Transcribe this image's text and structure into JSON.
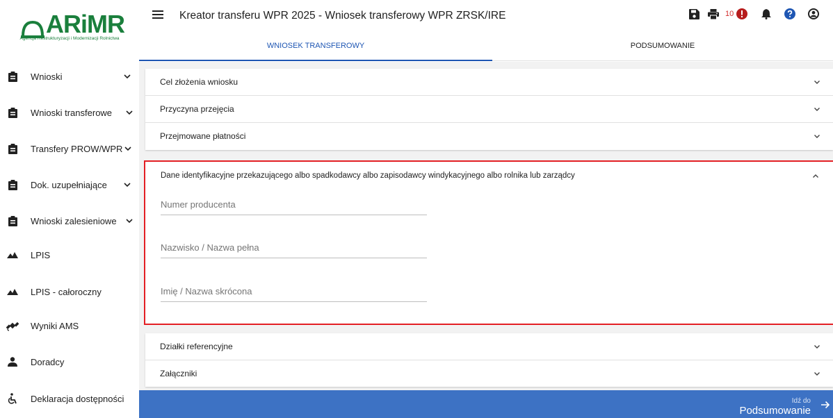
{
  "brand": {
    "name": "ARiMR",
    "subtitle": "Agencja Restrukturyzacji i Modernizacji Rolnictwa",
    "color": "#1a7f3c"
  },
  "header": {
    "title": "Kreator transferu WPR 2025 - Wniosek transferowy WPR ZRSK/IRE",
    "notification_count": "10",
    "icons": [
      "save-icon",
      "print-icon",
      "alert-icon",
      "bell-icon",
      "help-icon",
      "account-icon"
    ]
  },
  "sidebar": {
    "items": [
      {
        "label": "Wnioski",
        "icon": "clipboard-icon",
        "expandable": true
      },
      {
        "label": "Wnioski transferowe",
        "icon": "clipboard-icon",
        "expandable": true
      },
      {
        "label": "Transfery PROW/WPR",
        "icon": "clipboard-icon",
        "expandable": true
      },
      {
        "label": "Dok. uzupełniające",
        "icon": "clipboard-icon",
        "expandable": true
      },
      {
        "label": "Wnioski zalesieniowe",
        "icon": "clipboard-icon",
        "expandable": true
      },
      {
        "label": "LPIS",
        "icon": "terrain-icon",
        "expandable": false
      },
      {
        "label": "LPIS - całoroczny",
        "icon": "terrain-icon",
        "expandable": false
      },
      {
        "label": "Wyniki AMS",
        "icon": "satellite-icon",
        "expandable": false
      },
      {
        "label": "Doradcy",
        "icon": "person-icon",
        "expandable": false
      },
      {
        "label": "Deklaracja dostępności",
        "icon": "accessibility-icon",
        "expandable": false
      }
    ]
  },
  "tabs": [
    {
      "label": "WNIOSEK TRANSFEROWY",
      "active": true
    },
    {
      "label": "PODSUMOWANIE",
      "active": false
    }
  ],
  "sections_top": [
    {
      "label": "Cel złożenia wniosku"
    },
    {
      "label": "Przyczyna przejęcia"
    },
    {
      "label": "Przejmowane płatności"
    }
  ],
  "identification": {
    "title": "Dane identyfikacyjne przekazującego albo spadkodawcy albo zapisodawcy windykacyjnego albo rolnika lub zarządcy",
    "fields": [
      {
        "placeholder": "Numer producenta",
        "value": ""
      },
      {
        "placeholder": "Nazwisko / Nazwa pełna",
        "value": ""
      },
      {
        "placeholder": "Imię / Nazwa skrócona",
        "value": ""
      }
    ]
  },
  "sections_bottom": [
    {
      "label": "Działki referencyjne"
    },
    {
      "label": "Załączniki"
    }
  ],
  "footer": {
    "small": "Idź do",
    "big": "Podsumowanie"
  },
  "colors": {
    "primary": "#1e56b3",
    "footer": "#3d72c4",
    "highlight": "#e31e24",
    "alert": "#b71c1c"
  }
}
